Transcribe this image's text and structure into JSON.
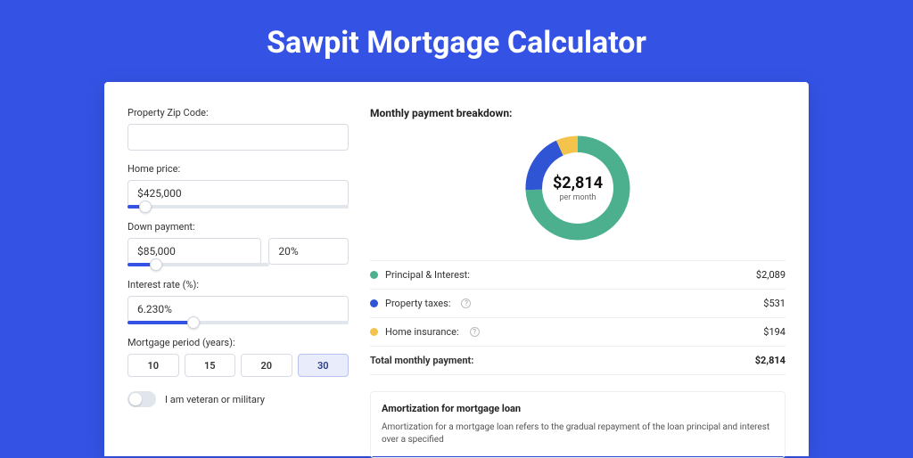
{
  "title": "Sawpit Mortgage Calculator",
  "form": {
    "zip_label": "Property Zip Code:",
    "zip_value": "",
    "home_price_label": "Home price:",
    "home_price_value": "$425,000",
    "home_price_slider_pct": 8,
    "down_payment_label": "Down payment:",
    "down_payment_value": "$85,000",
    "down_payment_pct": "20%",
    "down_payment_slider_pct": 20,
    "interest_label": "Interest rate (%):",
    "interest_value": "6.230%",
    "interest_slider_pct": 30,
    "period_label": "Mortgage period (years):",
    "periods": [
      "10",
      "15",
      "20",
      "30"
    ],
    "period_active_index": 3,
    "veteran_label": "I am veteran or military",
    "veteran_on": false
  },
  "breakdown": {
    "title": "Monthly payment breakdown:",
    "center_amount": "$2,814",
    "center_sub": "per month",
    "items": [
      {
        "label": "Principal & Interest:",
        "value": "$2,089",
        "color": "#4cb08f",
        "info": false,
        "num": 2089
      },
      {
        "label": "Property taxes:",
        "value": "$531",
        "color": "#2f55d4",
        "info": true,
        "num": 531
      },
      {
        "label": "Home insurance:",
        "value": "$194",
        "color": "#f3c34c",
        "info": true,
        "num": 194
      }
    ],
    "total_label": "Total monthly payment:",
    "total_value": "$2,814"
  },
  "amort": {
    "title": "Amortization for mortgage loan",
    "text": "Amortization for a mortgage loan refers to the gradual repayment of the loan principal and interest over a specified"
  },
  "chart_data": {
    "type": "pie",
    "title": "Monthly payment breakdown",
    "categories": [
      "Principal & Interest",
      "Property taxes",
      "Home insurance"
    ],
    "values": [
      2089,
      531,
      194
    ],
    "colors": [
      "#4cb08f",
      "#2f55d4",
      "#f3c34c"
    ],
    "total": 2814
  }
}
